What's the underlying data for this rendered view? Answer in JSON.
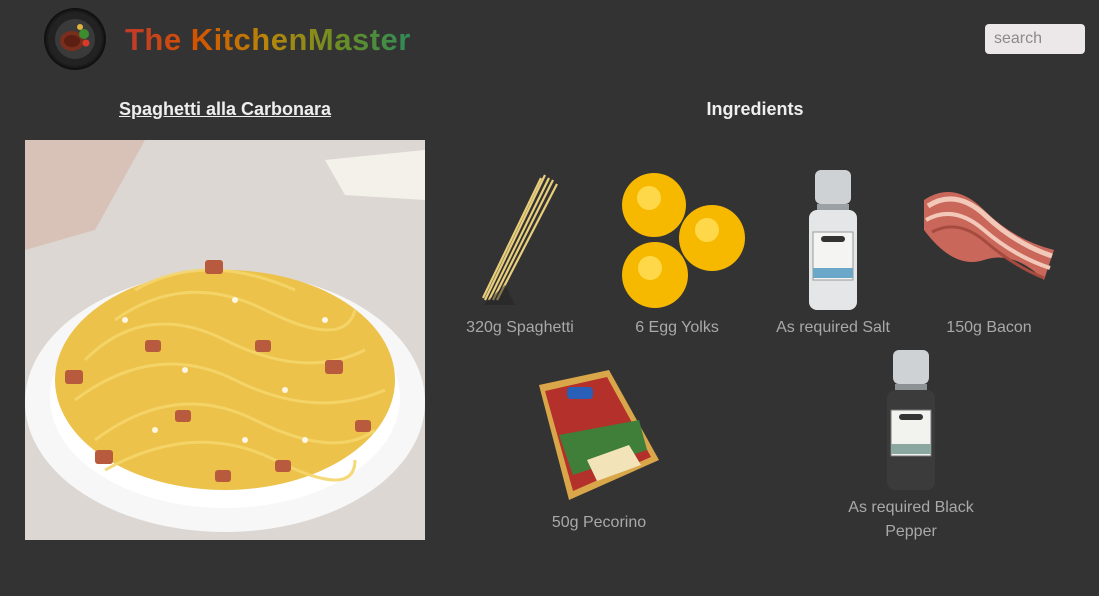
{
  "header": {
    "brand": "The KitchenMaster",
    "search_placeholder": "search"
  },
  "recipe": {
    "title": "Spaghetti alla Carbonara"
  },
  "ingredients_section": {
    "title": "Ingredients",
    "items": [
      {
        "label": "320g Spaghetti",
        "icon": "spaghetti-icon"
      },
      {
        "label": "6 Egg Yolks",
        "icon": "egg-yolks-icon"
      },
      {
        "label": "As required Salt",
        "icon": "salt-grinder-icon"
      },
      {
        "label": "150g Bacon",
        "icon": "bacon-icon"
      },
      {
        "label": "50g Pecorino",
        "icon": "pecorino-icon"
      },
      {
        "label": "As required Black Pepper",
        "icon": "pepper-grinder-icon"
      }
    ]
  },
  "colors": {
    "background": "#333333",
    "ingredient_label": "#a9a9a9",
    "title_text": "#eeeeee"
  }
}
